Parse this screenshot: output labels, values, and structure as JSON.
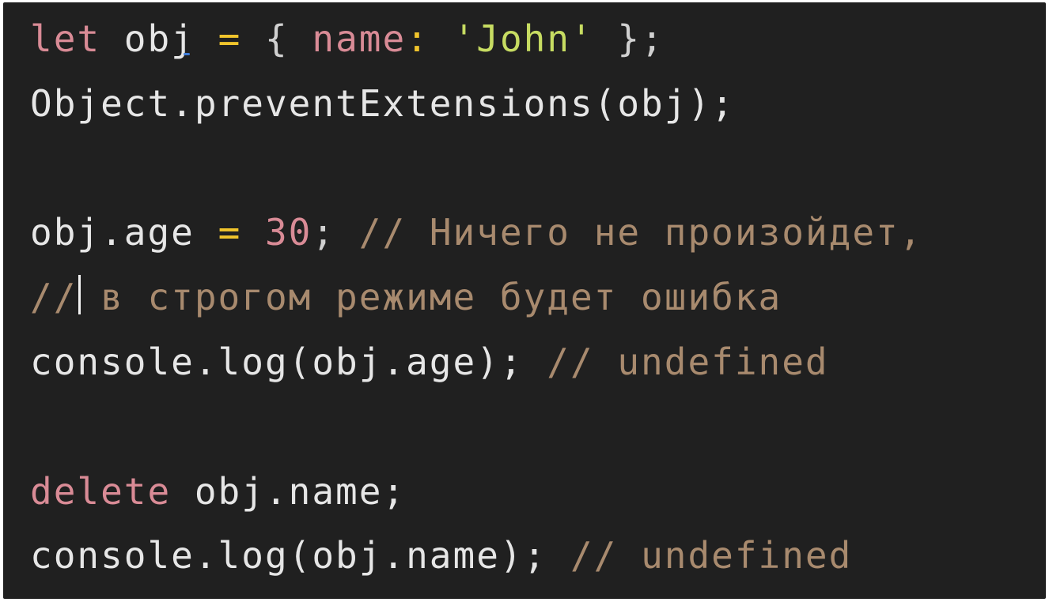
{
  "theme": {
    "background": "#202020",
    "colors": {
      "keyword": "#d98b96",
      "operator": "#f0c42c",
      "property": "#d98b96",
      "string": "#c7dc62",
      "number": "#d98b96",
      "comment": "#a88a6e",
      "text": "#e6e6e6",
      "punct": "#d0d0d0"
    }
  },
  "code": {
    "lines": [
      [
        {
          "t": "let",
          "k": "keyword"
        },
        {
          "t": " obj ",
          "k": "text"
        },
        {
          "t": "=",
          "k": "operator"
        },
        {
          "t": " { ",
          "k": "punct"
        },
        {
          "t": "name",
          "k": "property"
        },
        {
          "t": ":",
          "k": "operator"
        },
        {
          "t": " ",
          "k": "text"
        },
        {
          "t": "'John'",
          "k": "string"
        },
        {
          "t": " };",
          "k": "punct"
        }
      ],
      [
        {
          "t": "Object.preventExtensions(obj);",
          "k": "text"
        }
      ],
      [],
      [
        {
          "t": "obj.age ",
          "k": "text"
        },
        {
          "t": "=",
          "k": "operator"
        },
        {
          "t": " ",
          "k": "text"
        },
        {
          "t": "30",
          "k": "number"
        },
        {
          "t": "; ",
          "k": "punct"
        },
        {
          "t": "// Ничего не произойдет,",
          "k": "comment"
        }
      ],
      [
        {
          "t": "//",
          "k": "comment"
        },
        {
          "caret": true
        },
        {
          "t": " в строгом режиме будет ошибка",
          "k": "comment"
        }
      ],
      [
        {
          "t": "console.log(obj.age); ",
          "k": "text"
        },
        {
          "t": "// undefined",
          "k": "comment"
        }
      ],
      [],
      [
        {
          "t": "delete",
          "k": "keyword"
        },
        {
          "t": " obj.name;",
          "k": "text"
        }
      ],
      [
        {
          "t": "console.log(obj.name); ",
          "k": "text"
        },
        {
          "t": "// undefined",
          "k": "comment"
        }
      ]
    ]
  }
}
